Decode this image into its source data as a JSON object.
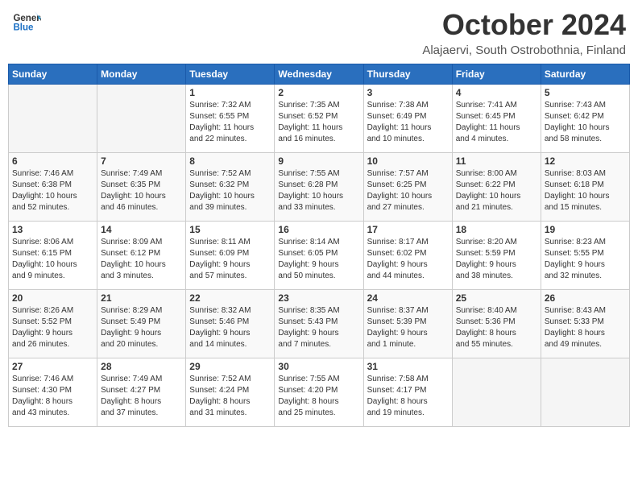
{
  "header": {
    "logo_line1": "General",
    "logo_line2": "Blue",
    "month": "October 2024",
    "location": "Alajaervi, South Ostrobothnia, Finland"
  },
  "weekdays": [
    "Sunday",
    "Monday",
    "Tuesday",
    "Wednesday",
    "Thursday",
    "Friday",
    "Saturday"
  ],
  "weeks": [
    [
      {
        "day": "",
        "content": ""
      },
      {
        "day": "",
        "content": ""
      },
      {
        "day": "1",
        "content": "Sunrise: 7:32 AM\nSunset: 6:55 PM\nDaylight: 11 hours\nand 22 minutes."
      },
      {
        "day": "2",
        "content": "Sunrise: 7:35 AM\nSunset: 6:52 PM\nDaylight: 11 hours\nand 16 minutes."
      },
      {
        "day": "3",
        "content": "Sunrise: 7:38 AM\nSunset: 6:49 PM\nDaylight: 11 hours\nand 10 minutes."
      },
      {
        "day": "4",
        "content": "Sunrise: 7:41 AM\nSunset: 6:45 PM\nDaylight: 11 hours\nand 4 minutes."
      },
      {
        "day": "5",
        "content": "Sunrise: 7:43 AM\nSunset: 6:42 PM\nDaylight: 10 hours\nand 58 minutes."
      }
    ],
    [
      {
        "day": "6",
        "content": "Sunrise: 7:46 AM\nSunset: 6:38 PM\nDaylight: 10 hours\nand 52 minutes."
      },
      {
        "day": "7",
        "content": "Sunrise: 7:49 AM\nSunset: 6:35 PM\nDaylight: 10 hours\nand 46 minutes."
      },
      {
        "day": "8",
        "content": "Sunrise: 7:52 AM\nSunset: 6:32 PM\nDaylight: 10 hours\nand 39 minutes."
      },
      {
        "day": "9",
        "content": "Sunrise: 7:55 AM\nSunset: 6:28 PM\nDaylight: 10 hours\nand 33 minutes."
      },
      {
        "day": "10",
        "content": "Sunrise: 7:57 AM\nSunset: 6:25 PM\nDaylight: 10 hours\nand 27 minutes."
      },
      {
        "day": "11",
        "content": "Sunrise: 8:00 AM\nSunset: 6:22 PM\nDaylight: 10 hours\nand 21 minutes."
      },
      {
        "day": "12",
        "content": "Sunrise: 8:03 AM\nSunset: 6:18 PM\nDaylight: 10 hours\nand 15 minutes."
      }
    ],
    [
      {
        "day": "13",
        "content": "Sunrise: 8:06 AM\nSunset: 6:15 PM\nDaylight: 10 hours\nand 9 minutes."
      },
      {
        "day": "14",
        "content": "Sunrise: 8:09 AM\nSunset: 6:12 PM\nDaylight: 10 hours\nand 3 minutes."
      },
      {
        "day": "15",
        "content": "Sunrise: 8:11 AM\nSunset: 6:09 PM\nDaylight: 9 hours\nand 57 minutes."
      },
      {
        "day": "16",
        "content": "Sunrise: 8:14 AM\nSunset: 6:05 PM\nDaylight: 9 hours\nand 50 minutes."
      },
      {
        "day": "17",
        "content": "Sunrise: 8:17 AM\nSunset: 6:02 PM\nDaylight: 9 hours\nand 44 minutes."
      },
      {
        "day": "18",
        "content": "Sunrise: 8:20 AM\nSunset: 5:59 PM\nDaylight: 9 hours\nand 38 minutes."
      },
      {
        "day": "19",
        "content": "Sunrise: 8:23 AM\nSunset: 5:55 PM\nDaylight: 9 hours\nand 32 minutes."
      }
    ],
    [
      {
        "day": "20",
        "content": "Sunrise: 8:26 AM\nSunset: 5:52 PM\nDaylight: 9 hours\nand 26 minutes."
      },
      {
        "day": "21",
        "content": "Sunrise: 8:29 AM\nSunset: 5:49 PM\nDaylight: 9 hours\nand 20 minutes."
      },
      {
        "day": "22",
        "content": "Sunrise: 8:32 AM\nSunset: 5:46 PM\nDaylight: 9 hours\nand 14 minutes."
      },
      {
        "day": "23",
        "content": "Sunrise: 8:35 AM\nSunset: 5:43 PM\nDaylight: 9 hours\nand 7 minutes."
      },
      {
        "day": "24",
        "content": "Sunrise: 8:37 AM\nSunset: 5:39 PM\nDaylight: 9 hours\nand 1 minute."
      },
      {
        "day": "25",
        "content": "Sunrise: 8:40 AM\nSunset: 5:36 PM\nDaylight: 8 hours\nand 55 minutes."
      },
      {
        "day": "26",
        "content": "Sunrise: 8:43 AM\nSunset: 5:33 PM\nDaylight: 8 hours\nand 49 minutes."
      }
    ],
    [
      {
        "day": "27",
        "content": "Sunrise: 7:46 AM\nSunset: 4:30 PM\nDaylight: 8 hours\nand 43 minutes."
      },
      {
        "day": "28",
        "content": "Sunrise: 7:49 AM\nSunset: 4:27 PM\nDaylight: 8 hours\nand 37 minutes."
      },
      {
        "day": "29",
        "content": "Sunrise: 7:52 AM\nSunset: 4:24 PM\nDaylight: 8 hours\nand 31 minutes."
      },
      {
        "day": "30",
        "content": "Sunrise: 7:55 AM\nSunset: 4:20 PM\nDaylight: 8 hours\nand 25 minutes."
      },
      {
        "day": "31",
        "content": "Sunrise: 7:58 AM\nSunset: 4:17 PM\nDaylight: 8 hours\nand 19 minutes."
      },
      {
        "day": "",
        "content": ""
      },
      {
        "day": "",
        "content": ""
      }
    ]
  ]
}
